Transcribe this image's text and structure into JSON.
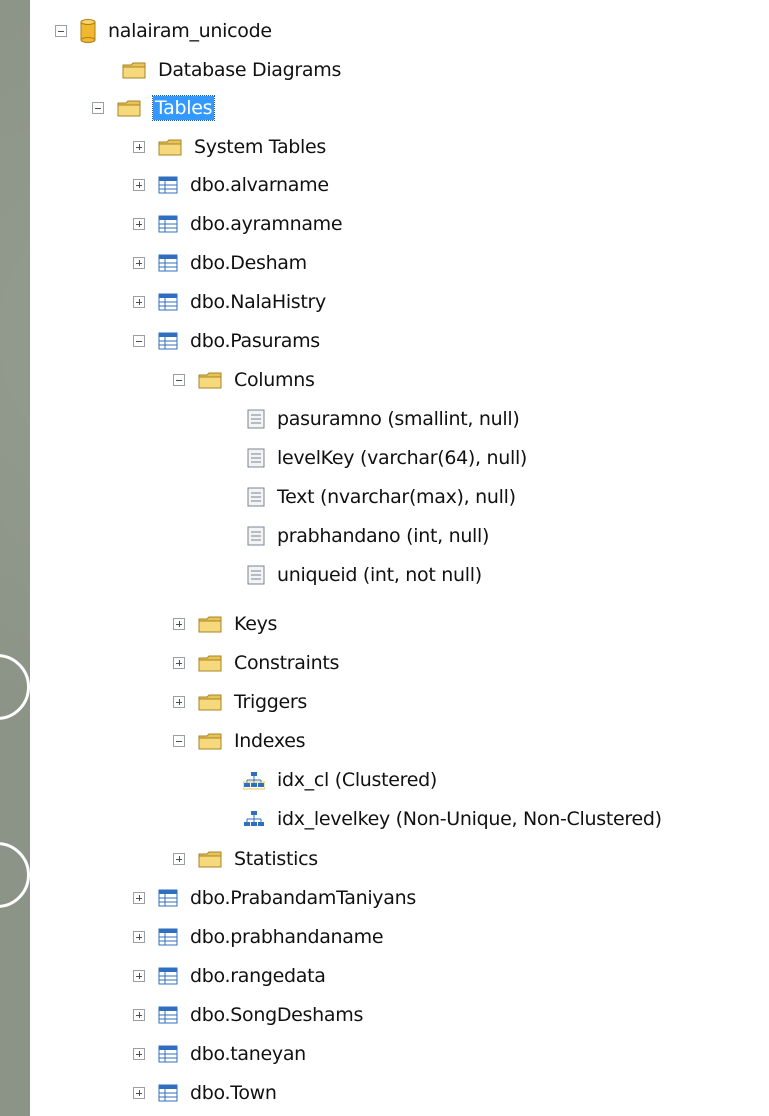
{
  "tree": {
    "database": "nalairam_unicode",
    "database_diagrams": "Database Diagrams",
    "tables": "Tables",
    "system_tables": "System Tables",
    "table_names": {
      "alvarname": "dbo.alvarname",
      "ayramname": "dbo.ayramname",
      "desham": "dbo.Desham",
      "nalahistry": "dbo.NalaHistry",
      "pasurams": "dbo.Pasurams",
      "prabandamtaniyans": "dbo.PrabandamTaniyans",
      "prabhandaname": "dbo.prabhandaname",
      "rangedata": "dbo.rangedata",
      "songdeshams": "dbo.SongDeshams",
      "taneyan": "dbo.taneyan",
      "town": "dbo.Town"
    },
    "pasurams_children": {
      "columns": "Columns",
      "keys": "Keys",
      "constraints": "Constraints",
      "triggers": "Triggers",
      "indexes": "Indexes",
      "statistics": "Statistics"
    },
    "columns": [
      "pasuramno (smallint, null)",
      "levelKey (varchar(64), null)",
      "Text (nvarchar(max), null)",
      "prabhandano (int, null)",
      "uniqueid (int, not null)"
    ],
    "indexes": [
      "idx_cl (Clustered)",
      "idx_levelkey (Non-Unique, Non-Clustered)"
    ]
  },
  "colors": {
    "selection": "#3399ff",
    "folder": "#e8c35a",
    "table_icon": "#2f6fbf",
    "database_icon": "#f0b830"
  },
  "icons": {
    "database": "database-cylinder-icon",
    "folder": "folder-icon",
    "table": "table-grid-icon",
    "column": "column-icon",
    "index": "index-tree-icon",
    "expander_minus": "minus-box-icon",
    "expander_plus": "plus-box-icon"
  }
}
